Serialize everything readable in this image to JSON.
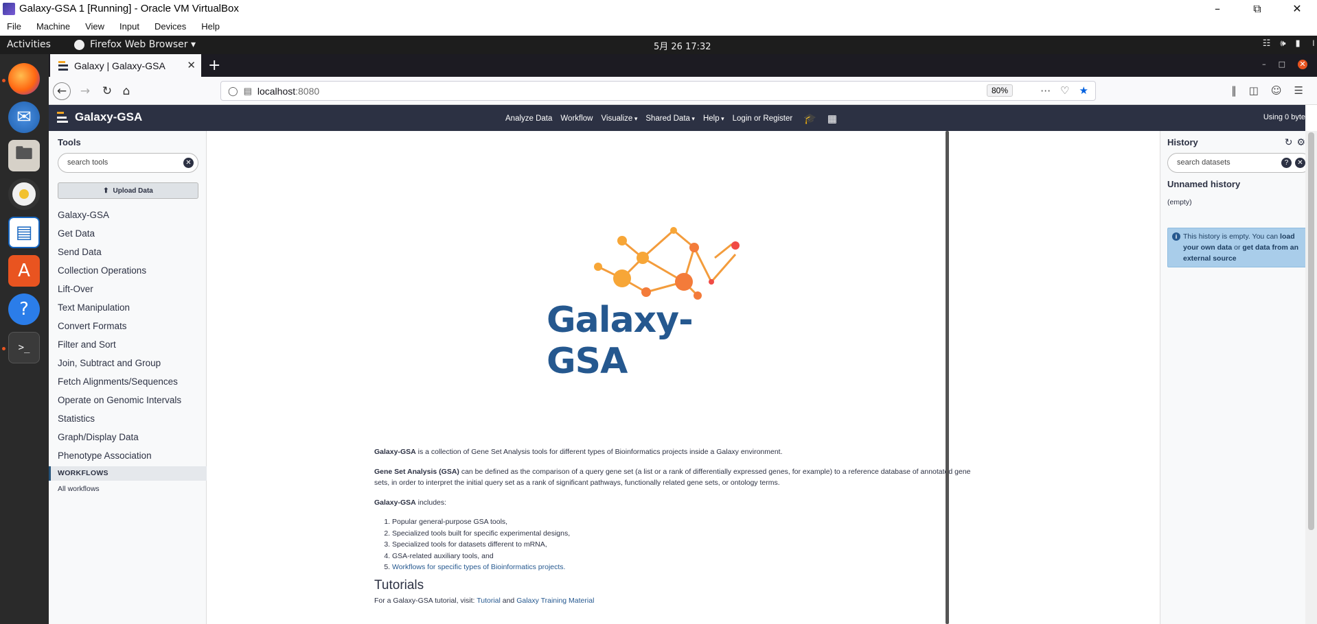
{
  "vbox": {
    "title": "Galaxy-GSA 1 [Running] - Oracle VM VirtualBox",
    "menu": [
      "File",
      "Machine",
      "View",
      "Input",
      "Devices",
      "Help"
    ]
  },
  "ubuntu": {
    "activities": "Activities",
    "app_menu": "Firefox Web Browser",
    "clock": "5月 26  17:32"
  },
  "browser": {
    "tab_title": "Galaxy | Galaxy-GSA",
    "url_host": "localhost",
    "url_port": ":8080",
    "zoom": "80%"
  },
  "masthead": {
    "brand": "Galaxy-GSA",
    "nav": [
      "Analyze Data",
      "Workflow",
      "Visualize",
      "Shared Data",
      "Help",
      "Login or Register"
    ],
    "quota": "Using 0 byte"
  },
  "tools": {
    "title": "Tools",
    "search_placeholder": "search tools",
    "upload_label": "Upload Data",
    "sections": [
      "Galaxy-GSA",
      "Get Data",
      "Send Data",
      "Collection Operations",
      "Lift-Over",
      "Text Manipulation",
      "Convert Formats",
      "Filter and Sort",
      "Join, Subtract and Group",
      "Fetch Alignments/Sequences",
      "Operate on Genomic Intervals",
      "Statistics",
      "Graph/Display Data",
      "Phenotype Association"
    ],
    "workflows_header": "WORKFLOWS",
    "all_workflows": "All workflows"
  },
  "center": {
    "logo_text": "Galaxy-GSA",
    "p1_bold": "Galaxy-GSA",
    "p1_rest": " is a collection of Gene Set Analysis tools for different types of Bioinformatics projects inside a Galaxy environment.",
    "p2_bold": "Gene Set Analysis (GSA)",
    "p2_rest": " can be defined as the comparison of a query gene set (a list or a rank of differentially expressed genes, for example) to a reference database of annotated gene sets, in order to interpret the initial query set as a rank of significant pathways, functionally related gene sets, or ontology terms.",
    "p3_bold": "Galaxy-GSA",
    "p3_rest": " includes:",
    "list": [
      "Popular general-purpose GSA tools,",
      "Specialized tools built for specific experimental designs,",
      "Specialized tools for datasets different to mRNA,",
      "GSA-related auxiliary tools, and"
    ],
    "list_link": "Workflows for specific types of Bioinformatics projects.",
    "tutorials_heading": "Tutorials",
    "tutorial_prefix": "For a Galaxy-GSA tutorial, visit: ",
    "tutorial_link": "Tutorial",
    "tutorial_and": " and ",
    "training_link": "Galaxy Training Material"
  },
  "history": {
    "title": "History",
    "search_placeholder": "search datasets",
    "name": "Unnamed history",
    "empty": "(empty)",
    "msg_prefix": "This history is empty. You can ",
    "msg_link1": "load your own data",
    "msg_mid": " or ",
    "msg_link2": "get data from an external source"
  },
  "colors": {
    "masthead": "#2c3143",
    "logo_blue": "#25588f",
    "logo_orange": "#f5a623",
    "info_bg": "#a9cdea"
  }
}
